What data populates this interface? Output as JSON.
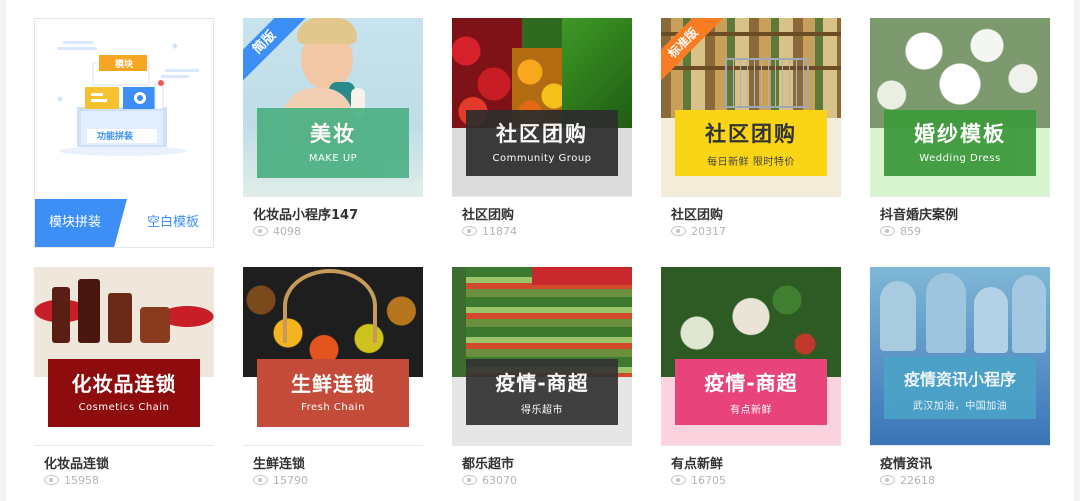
{
  "colors": {
    "primary": "#3d8ff5"
  },
  "blank_card": {
    "title_primary": "模块拼装",
    "title_secondary": "空白模板",
    "illustration_title": "功能拼装",
    "illustration_tag": "模块"
  },
  "templates": [
    {
      "name": "化妆品小程序147",
      "views": "4098",
      "banner_title": "美妆",
      "banner_sub": "MAKE UP",
      "ribbon": "简版",
      "ribbon_color": "#3d8ff5",
      "band_color": "#4cb084"
    },
    {
      "name": "社区团购",
      "views": "11874",
      "banner_title": "社区团购",
      "banner_sub": "Community Group",
      "band_color": "#2d2d2d"
    },
    {
      "name": "社区团购",
      "views": "20317",
      "banner_title": "社区团购",
      "banner_sub": "每日新鲜 限时特价",
      "ribbon": "标准版",
      "ribbon_color": "#f97b22",
      "band_color": "#f9d516"
    },
    {
      "name": "抖音婚庆案例",
      "views": "859",
      "banner_title": "婚纱模板",
      "banner_sub": "Wedding Dress",
      "band_color": "#3e9a3c"
    },
    {
      "name": "化妆品连锁",
      "views": "15958",
      "banner_title": "化妆品连锁",
      "banner_sub": "Cosmetics Chain",
      "band_color": "#8e0b0e"
    },
    {
      "name": "生鲜连锁",
      "views": "15790",
      "banner_title": "生鲜连锁",
      "banner_sub": "Fresh Chain",
      "band_color": "#c44a3a"
    },
    {
      "name": "都乐超市",
      "views": "63070",
      "banner_title": "疫情-商超",
      "banner_sub": "得乐超市",
      "band_color": "#333333"
    },
    {
      "name": "有点新鲜",
      "views": "16705",
      "banner_title": "疫情-商超",
      "banner_sub": "有点新鲜",
      "band_color": "#e8437a"
    },
    {
      "name": "疫情资讯",
      "views": "22618",
      "banner_title": "疫情资讯小程序",
      "banner_sub": "武汉加油，中国加油",
      "band_color": "#4aa3c7"
    }
  ]
}
